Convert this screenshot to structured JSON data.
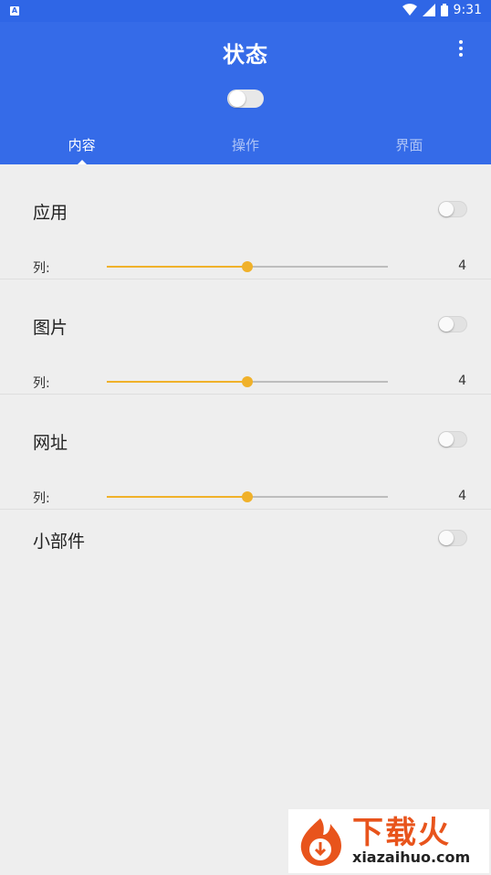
{
  "status_bar": {
    "time": "9:31",
    "notification_icon": "a-icon",
    "icons": [
      "wifi-icon",
      "signal-icon",
      "battery-icon"
    ]
  },
  "app_bar": {
    "title": "状态",
    "menu_icon": "more-vert-icon",
    "master_toggle": false
  },
  "tabs": [
    {
      "label": "内容",
      "active": true
    },
    {
      "label": "操作",
      "active": false
    },
    {
      "label": "界面",
      "active": false
    }
  ],
  "sections": [
    {
      "title": "应用",
      "enabled": false,
      "column_label": "列:",
      "columns": "4",
      "slider_fraction": 0.5
    },
    {
      "title": "图片",
      "enabled": false,
      "column_label": "列:",
      "columns": "4",
      "slider_fraction": 0.5
    },
    {
      "title": "网址",
      "enabled": false,
      "column_label": "列:",
      "columns": "4",
      "slider_fraction": 0.5
    },
    {
      "title": "小部件",
      "enabled": false
    }
  ],
  "colors": {
    "primary": "#356be8",
    "accent": "#f0b12a",
    "background": "#eeeeee"
  },
  "watermark": {
    "brand": "下载火",
    "url": "xiazaihuo.com"
  }
}
